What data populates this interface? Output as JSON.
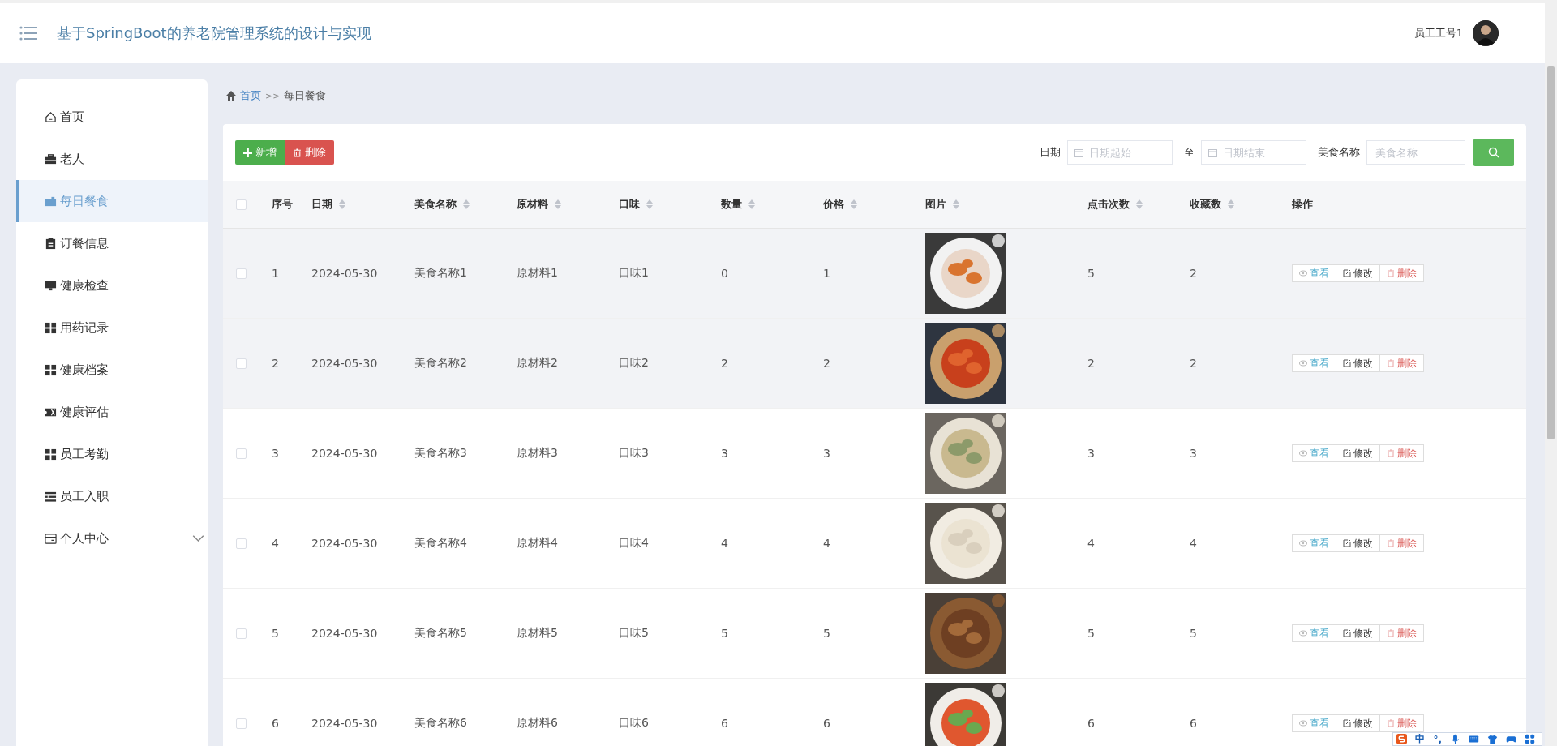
{
  "header": {
    "title": "基于SpringBoot的养老院管理系统的设计与实现",
    "user": "员工工号1"
  },
  "sidebar": {
    "items": [
      {
        "label": "首页",
        "selected": false
      },
      {
        "label": "老人",
        "selected": false
      },
      {
        "label": "每日餐食",
        "selected": true
      },
      {
        "label": "订餐信息",
        "selected": false
      },
      {
        "label": "健康检查",
        "selected": false
      },
      {
        "label": "用药记录",
        "selected": false
      },
      {
        "label": "健康档案",
        "selected": false
      },
      {
        "label": "健康评估",
        "selected": false
      },
      {
        "label": "员工考勤",
        "selected": false
      },
      {
        "label": "员工入职",
        "selected": false
      },
      {
        "label": "个人中心",
        "selected": false,
        "expanded": false
      }
    ]
  },
  "breadcrumb": [
    {
      "label": "首页",
      "kind": "link"
    },
    {
      "label": ">>",
      "kind": "separator"
    },
    {
      "label": "每日餐食",
      "kind": "current"
    }
  ],
  "toolbar": {
    "buttons": [
      {
        "label": "新增",
        "kind": "add"
      },
      {
        "label": "删除",
        "kind": "delete"
      }
    ],
    "filters": [
      {
        "label": "日期",
        "placeholder": "日期起始",
        "kind": "date"
      },
      {
        "label": "至",
        "placeholder": "日期结束",
        "kind": "date"
      },
      {
        "label": "美食名称",
        "placeholder": "美食名称",
        "kind": "text"
      }
    ]
  },
  "table": {
    "select_all_checked": false,
    "columns": [
      {
        "label": "序号",
        "sortable": false
      },
      {
        "label": "日期",
        "sortable": true
      },
      {
        "label": "美食名称",
        "sortable": true
      },
      {
        "label": "原材料",
        "sortable": true
      },
      {
        "label": "口味",
        "sortable": true
      },
      {
        "label": "数量",
        "sortable": true
      },
      {
        "label": "价格",
        "sortable": true
      },
      {
        "label": "图片",
        "sortable": true
      },
      {
        "label": "点击次数",
        "sortable": true
      },
      {
        "label": "收藏数",
        "sortable": true
      },
      {
        "label": "操作",
        "sortable": false
      }
    ],
    "rows": [
      {
        "checked": false,
        "highlighted": true,
        "cells": [
          "1",
          "2024-05-30",
          "美食名称1",
          "原材料1",
          "口味1",
          "0",
          "1"
        ],
        "clicks": "5",
        "favorites": "2",
        "actions": [
          {
            "label": "查看",
            "kind": "view"
          },
          {
            "label": "修改",
            "kind": "edit"
          },
          {
            "label": "删除",
            "kind": "delete"
          }
        ]
      },
      {
        "checked": false,
        "highlighted": true,
        "cells": [
          "2",
          "2024-05-30",
          "美食名称2",
          "原材料2",
          "口味2",
          "2",
          "2"
        ],
        "clicks": "2",
        "favorites": "2",
        "actions": [
          {
            "label": "查看",
            "kind": "view"
          },
          {
            "label": "修改",
            "kind": "edit"
          },
          {
            "label": "删除",
            "kind": "delete"
          }
        ]
      },
      {
        "checked": false,
        "highlighted": false,
        "cells": [
          "3",
          "2024-05-30",
          "美食名称3",
          "原材料3",
          "口味3",
          "3",
          "3"
        ],
        "clicks": "3",
        "favorites": "3",
        "actions": [
          {
            "label": "查看",
            "kind": "view"
          },
          {
            "label": "修改",
            "kind": "edit"
          },
          {
            "label": "删除",
            "kind": "delete"
          }
        ]
      },
      {
        "checked": false,
        "highlighted": false,
        "cells": [
          "4",
          "2024-05-30",
          "美食名称4",
          "原材料4",
          "口味4",
          "4",
          "4"
        ],
        "clicks": "4",
        "favorites": "4",
        "actions": [
          {
            "label": "查看",
            "kind": "view"
          },
          {
            "label": "修改",
            "kind": "edit"
          },
          {
            "label": "删除",
            "kind": "delete"
          }
        ]
      },
      {
        "checked": false,
        "highlighted": false,
        "cells": [
          "5",
          "2024-05-30",
          "美食名称5",
          "原材料5",
          "口味5",
          "5",
          "5"
        ],
        "clicks": "5",
        "favorites": "5",
        "actions": [
          {
            "label": "查看",
            "kind": "view"
          },
          {
            "label": "修改",
            "kind": "edit"
          },
          {
            "label": "删除",
            "kind": "delete"
          }
        ]
      },
      {
        "checked": false,
        "highlighted": false,
        "cells": [
          "6",
          "2024-05-30",
          "美食名称6",
          "原材料6",
          "口味6",
          "6",
          "6"
        ],
        "clicks": "6",
        "favorites": "6",
        "actions": [
          {
            "label": "查看",
            "kind": "view"
          },
          {
            "label": "修改",
            "kind": "edit"
          },
          {
            "label": "删除",
            "kind": "delete"
          }
        ]
      }
    ]
  },
  "ime_bar": {
    "mode": "中",
    "punctuation": "°,"
  }
}
